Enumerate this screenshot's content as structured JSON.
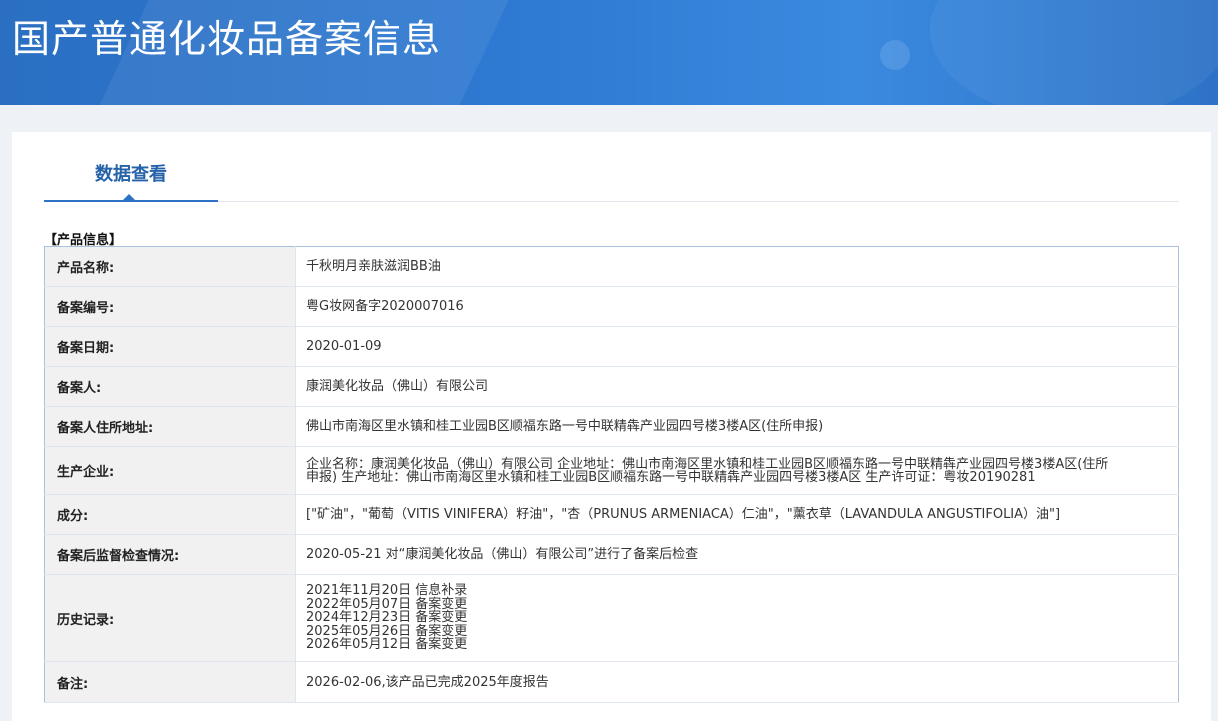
{
  "header": {
    "title": "国产普通化妆品备案信息"
  },
  "tabs": [
    {
      "label": "数据查看"
    }
  ],
  "section": {
    "title": "【产品信息】"
  },
  "rows": [
    {
      "label": "产品名称:",
      "value": "千秋明月亲肤滋润BB油"
    },
    {
      "label": "备案编号:",
      "value": "粤G妆网备字2020007016"
    },
    {
      "label": "备案日期:",
      "value": "2020-01-09"
    },
    {
      "label": "备案人:",
      "value": "康润美化妆品（佛山）有限公司"
    },
    {
      "label": "备案人住所地址:",
      "value": "佛山市南海区里水镇和桂工业园B区顺福东路一号中联精犇产业园四号楼3楼A区(住所申报)"
    },
    {
      "label": "生产企业:",
      "value": "企业名称：康润美化妆品（佛山）有限公司 企业地址：佛山市南海区里水镇和桂工业园B区顺福东路一号中联精犇产业园四号楼3楼A区(住所申报) 生产地址：佛山市南海区里水镇和桂工业园B区顺福东路一号中联精犇产业园四号楼3楼A区 生产许可证：粤妆20190281"
    },
    {
      "label": "成分:",
      "value": "[\"矿油\"，\"葡萄（VITIS VINIFERA）籽油\"，\"杏（PRUNUS ARMENIACA）仁油\"，\"薰衣草（LAVANDULA ANGUSTIFOLIA）油\"]"
    },
    {
      "label": "备案后监督检查情况:",
      "value": "2020-05-21 对“康润美化妆品（佛山）有限公司”进行了备案后检查"
    },
    {
      "label": "历史记录:",
      "lines": [
        "2021年11月20日 信息补录",
        "2022年05月07日 备案变更",
        "2024年12月23日 备案变更",
        "2025年05月26日 备案变更",
        "2026年05月12日 备案变更"
      ]
    },
    {
      "label": "备注:",
      "value": "2026-02-06,该产品已完成2025年度报告"
    }
  ]
}
